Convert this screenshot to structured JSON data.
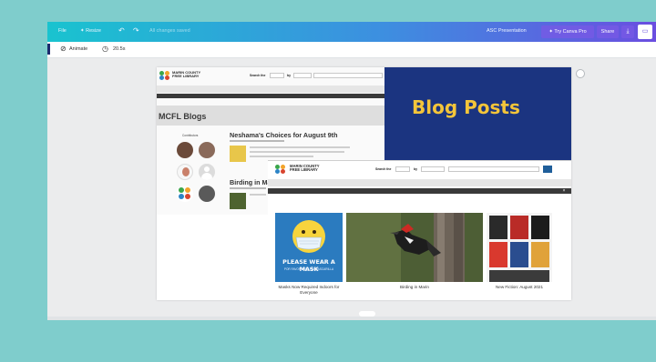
{
  "topbar": {
    "file": "File",
    "resize": "✦ Resize",
    "undo_icon": "undo-icon",
    "redo_icon": "redo-icon",
    "saved_status": "All changes saved",
    "doc_title": "ASC Presentation",
    "try_pro": "✦ Try Canva Pro",
    "share": "Share",
    "download_icon": "download-icon",
    "present_icon": "present-icon"
  },
  "subbar": {
    "animate": "Animate",
    "duration": "20.5s"
  },
  "slide": {
    "title_card": "Blog Posts",
    "colors": {
      "card_bg": "#1b3480",
      "card_text": "#f4c53a"
    }
  },
  "blog_shot": {
    "library_name_1": "MARIN COUNTY",
    "library_name_2": "FREE LIBRARY",
    "search_label": "Search the",
    "search_by": "by",
    "page_title": "MCFL Blogs",
    "contributors": "Contributors",
    "post_1_title": "Neshama's Choices for August 9th",
    "post_2_title": "Birding in Ma"
  },
  "home_shot": {
    "library_name_1": "MARIN COUNTY",
    "library_name_2": "FREE LIBRARY",
    "search_label": "Search the",
    "search_by": "by",
    "mask_title": "PLEASE WEAR A MASK",
    "mask_sub": "POR FAVOR USE UNA MASCARILLA",
    "cards": [
      {
        "caption": "Masks Now Required Indoors for Everyone"
      },
      {
        "caption": "Birding in Marin"
      },
      {
        "caption": "New Fiction: August 2021"
      }
    ]
  }
}
